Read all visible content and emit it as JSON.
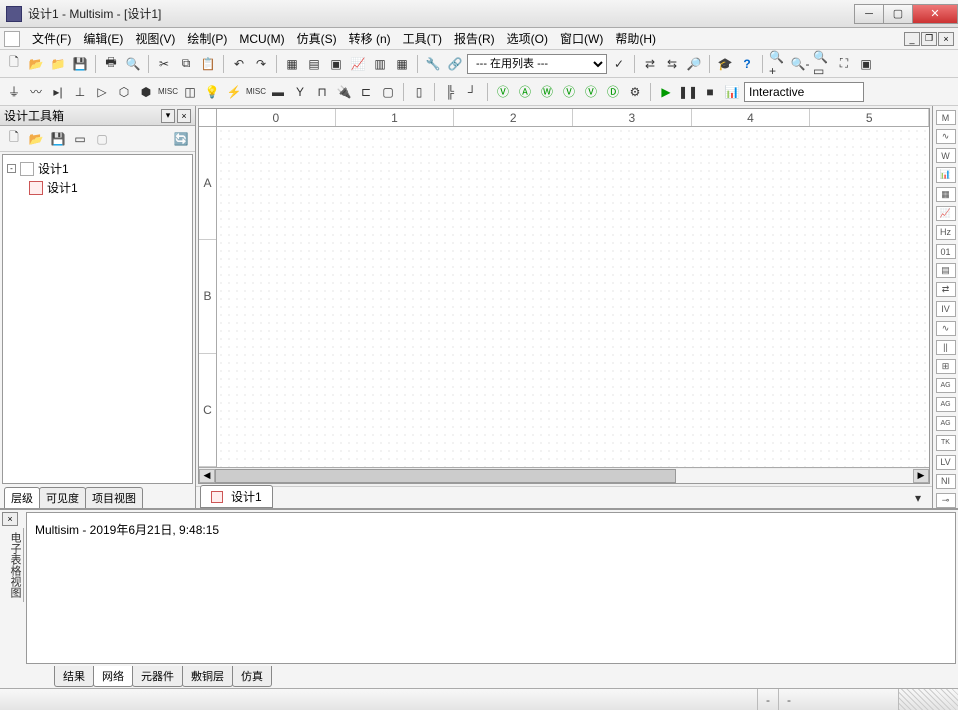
{
  "title": "设计1 - Multisim - [设计1]",
  "menu": {
    "file": "文件(F)",
    "edit": "编辑(E)",
    "view": "视图(V)",
    "draw": "绘制(P)",
    "mcu": "MCU(M)",
    "sim": "仿真(S)",
    "transfer": "转移 (n)",
    "tools": "工具(T)",
    "reports": "报告(R)",
    "options": "选项(O)",
    "window": "窗口(W)",
    "help": "帮助(H)"
  },
  "combo": {
    "inuse": "--- 在用列表 ---"
  },
  "sim_label": "Interactive",
  "left_panel": {
    "title": "设计工具箱",
    "tree_root": "设计1",
    "tree_child": "设计1",
    "tabs": {
      "hier": "层级",
      "vis": "可见度",
      "proj": "项目视图"
    }
  },
  "ruler_h": [
    "0",
    "1",
    "2",
    "3",
    "4",
    "5"
  ],
  "ruler_v": [
    "A",
    "B",
    "C"
  ],
  "doc_tab": "设计1",
  "bottom": {
    "side": "电子表格视图",
    "log": "Multisim  -  2019年6月21日, 9:48:15",
    "tabs": {
      "result": "结果",
      "net": "网络",
      "comp": "元器件",
      "copper": "敷铜层",
      "sim": "仿真"
    }
  },
  "status": {
    "seg1": "-",
    "seg2": "-"
  }
}
